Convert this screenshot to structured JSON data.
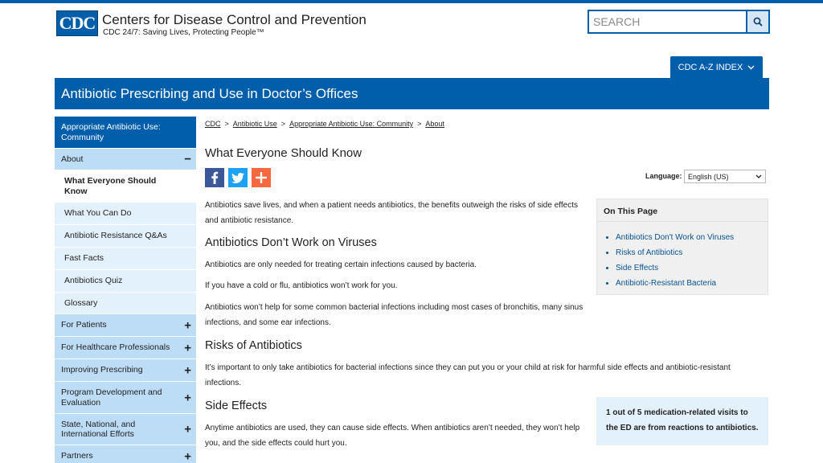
{
  "header": {
    "logo_text": "CDC",
    "site_title": "Centers for Disease Control and Prevention",
    "tagline": "CDC 24/7: Saving Lives, Protecting People™",
    "search_placeholder": "SEARCH",
    "az_label": "CDC A-Z INDEX"
  },
  "page_title": "Antibiotic Prescribing and Use in Doctor’s Offices",
  "sidebar": {
    "heading": "Appropriate Antibiotic Use: Community",
    "items": [
      {
        "label": "About",
        "sign": "−"
      },
      {
        "label": "What Everyone Should Know"
      },
      {
        "label": "What You Can Do"
      },
      {
        "label": "Antibiotic Resistance Q&As"
      },
      {
        "label": "Fast Facts"
      },
      {
        "label": "Antibiotics Quiz"
      },
      {
        "label": "Glossary"
      },
      {
        "label": "For Patients",
        "sign": "+"
      },
      {
        "label": "For Healthcare Professionals",
        "sign": "+"
      },
      {
        "label": "Improving Prescribing",
        "sign": "+"
      },
      {
        "label": "Program Development and Evaluation",
        "sign": "+"
      },
      {
        "label": "State, National, and International Efforts",
        "sign": "+"
      },
      {
        "label": "Partners",
        "sign": "+"
      }
    ]
  },
  "breadcrumb": {
    "items": [
      "CDC",
      "Antibiotic Use",
      "Appropriate Antibiotic Use: Community",
      "About"
    ],
    "separator": ">"
  },
  "main": {
    "heading": "What Everyone Should Know",
    "language_label": "Language:",
    "language_value": "English (US)",
    "intro": "Antibiotics save lives, and when a patient needs antibiotics, the benefits outweigh the risks of side effects and antibiotic resistance.",
    "section1_title": "Antibiotics Don’t Work on Viruses",
    "section1_p1": "Antibiotics are only needed for treating certain infections caused by bacteria.",
    "section1_p2": "If you have a cold or flu, antibiotics won’t work for you.",
    "section1_p3": "Antibiotics won’t help for some common bacterial infections including most cases of bronchitis, many sinus infections, and some ear infections.",
    "section2_title": "Risks of Antibiotics",
    "section2_p1": "It’s important to only take antibiotics for bacterial infections since they can put you or your child at risk for harmful side effects and antibiotic-resistant infections.",
    "section3_title": "Side Effects",
    "section3_p1": "Anytime antibiotics are used, they can cause side effects. When antibiotics aren’t needed, they won’t help you, and the side effects could hurt you."
  },
  "on_this_page": {
    "heading": "On This Page",
    "links": [
      "Antibiotics Don't Work on Viruses",
      "Risks of Antibiotics",
      "Side Effects",
      "Antibiotic-Resistant Bacteria"
    ]
  },
  "callout": {
    "text": "1 out of 5 medication-related visits to the ED are from reactions to antibiotics."
  },
  "icons": {
    "search": "search-icon",
    "chevron": "chevron-down-icon",
    "facebook": "facebook-icon",
    "twitter": "twitter-icon",
    "add": "add-share-icon"
  },
  "colors": {
    "brand_blue": "#005eaa",
    "sidebar_parent": "#bddcf5",
    "sidebar_child": "#e3f1fc",
    "link": "#075290"
  }
}
